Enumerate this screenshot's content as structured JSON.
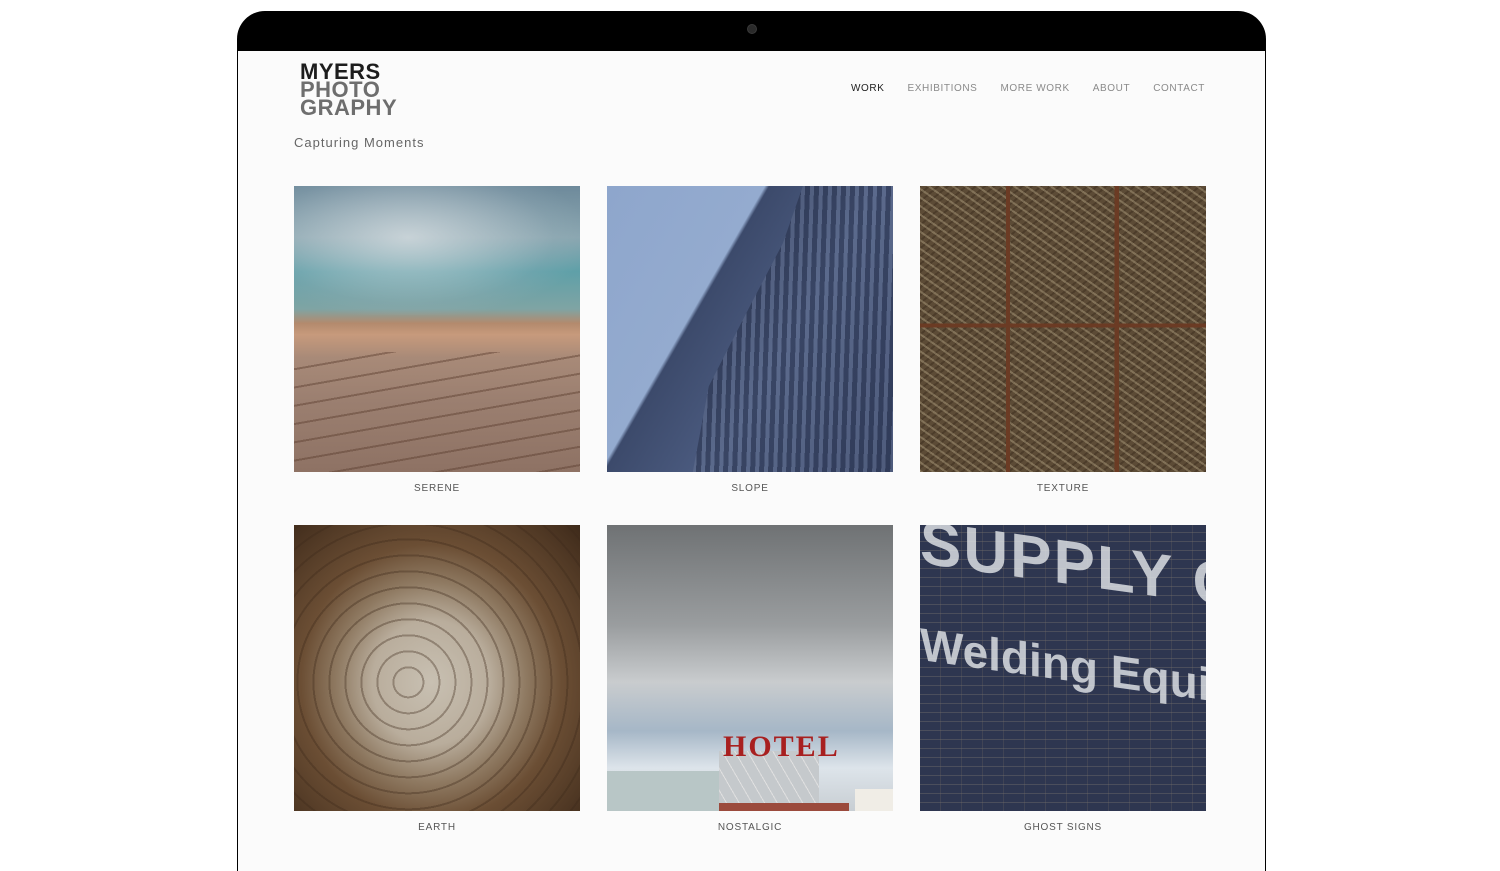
{
  "logo": {
    "line1": "MYERS",
    "line2": "PHOTO",
    "line3": "GRAPHY"
  },
  "nav": {
    "items": [
      {
        "label": "WORK",
        "active": true
      },
      {
        "label": "EXHIBITIONS",
        "active": false
      },
      {
        "label": "MORE WORK",
        "active": false
      },
      {
        "label": "ABOUT",
        "active": false
      },
      {
        "label": "CONTACT",
        "active": false
      }
    ]
  },
  "tagline": "Capturing Moments",
  "gallery": {
    "items": [
      {
        "caption": "SERENE"
      },
      {
        "caption": "SLOPE"
      },
      {
        "caption": "TEXTURE"
      },
      {
        "caption": "EARTH"
      },
      {
        "caption": "NOSTALGIC",
        "sign_text": "HOTEL"
      },
      {
        "caption": "GHOST SIGNS",
        "sign_text_1": "SUPPLY CO",
        "sign_text_2": "Welding Equipment"
      }
    ]
  },
  "colors": {
    "page_bg": "#fbfbfb",
    "nav_active": "#1d1d1d",
    "nav_inactive": "#8a8a8a",
    "device_bezel": "#000000"
  }
}
